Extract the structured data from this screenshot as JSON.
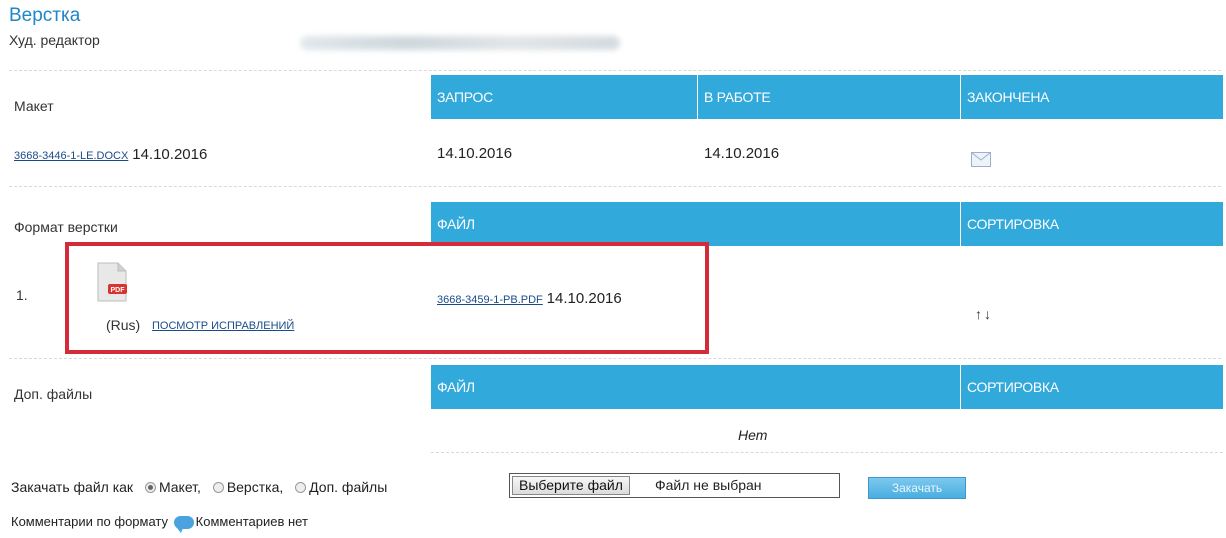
{
  "section_title": "Верстка",
  "editor_label": "Худ. редактор",
  "maket": {
    "label": "Макет",
    "headers": [
      "ЗАПРОС",
      "В РАБОТЕ",
      "ЗАКОНЧЕНА"
    ],
    "file_link": "3668-3446-1-LE.DOCX",
    "file_date": "14.10.2016",
    "request_date": "14.10.2016",
    "work_date": "14.10.2016",
    "done_icon": "envelope-icon"
  },
  "layout_format": {
    "label": "Формат верстки",
    "header_file": "ФАЙЛ",
    "header_sort": "СОРТИРОВКА",
    "row_number": "1.",
    "pdf_icon_text": "PDF",
    "lang": "(Rus)",
    "view_corrections": "ПОСМОТР ИСПРАВЛЕНИЙ",
    "file_link": "3668-3459-1-PB.PDF",
    "file_date": "14.10.2016",
    "sort_arrows": "↑↓"
  },
  "extra_files": {
    "label": "Доп. файлы",
    "header_file": "ФАЙЛ",
    "header_sort": "СОРТИРОВКА",
    "empty_text": "Нет"
  },
  "upload": {
    "label": "Закачать файл как",
    "options": [
      "Макет,",
      "Верстка,",
      "Доп. файлы"
    ],
    "selected": "Макет,",
    "choose_file_button": "Выберите файл",
    "no_file_text": "Файл не выбран",
    "submit_button": "Закачать"
  },
  "comments": {
    "label": "Комментарии по формату",
    "icon": "comment-bubble-icon",
    "status": "Комментариев нет"
  },
  "colors": {
    "header_bg": "#31a9db",
    "title": "#1f86c8",
    "highlight_box": "#d42b3b"
  }
}
